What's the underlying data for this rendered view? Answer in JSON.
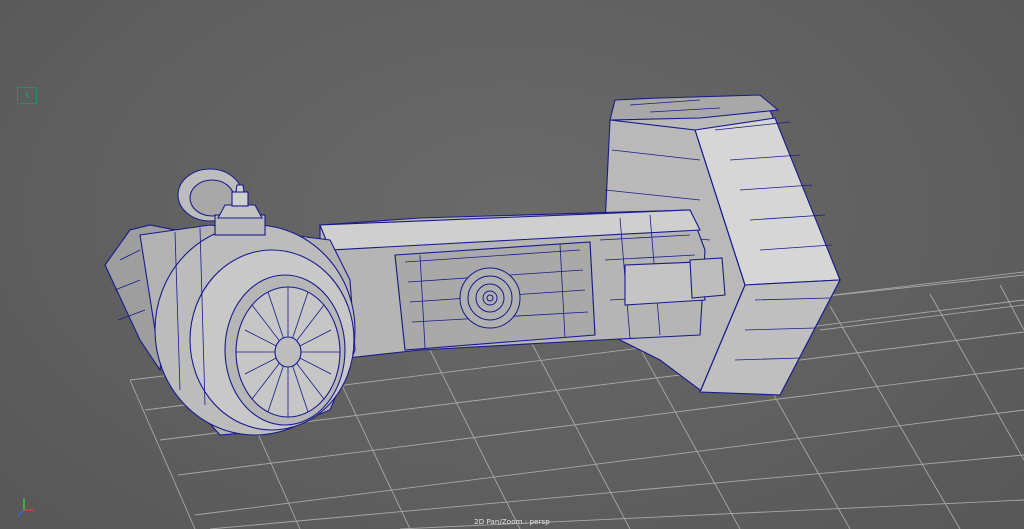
{
  "viewport": {
    "camera_name": "persp",
    "status_text": "2D Pan/Zoom : persp",
    "background_color": "#5d5d5d",
    "grid_color": "#b4b4b4",
    "wire_color": "#1a1a8c",
    "model_shade_color": "#c8c8c8"
  },
  "gizmo": {
    "axes": [
      "x",
      "y",
      "z"
    ],
    "x_color": "#d23c3c",
    "y_color": "#3cc83c",
    "z_color": "#3c64dc"
  },
  "icons": {
    "view_cube": "view-cube-icon",
    "axis_gizmo": "axis-gizmo-icon"
  }
}
